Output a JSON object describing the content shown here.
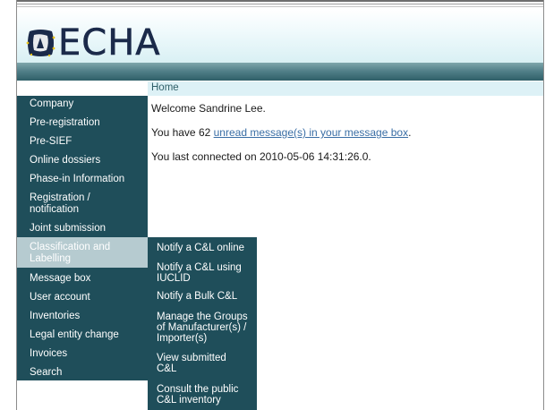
{
  "header": {
    "logo_text": "ECHA",
    "logo_icon": "echa-logo-icon"
  },
  "breadcrumb": {
    "home": "Home"
  },
  "sidebar": {
    "items": [
      {
        "label": "Company"
      },
      {
        "label": "Pre-registration"
      },
      {
        "label": "Pre-SIEF"
      },
      {
        "label": "Online dossiers"
      },
      {
        "label": "Phase-in Information"
      },
      {
        "label": "Registration /\nnotification"
      },
      {
        "label": "Joint submission"
      },
      {
        "label": "Classification and\nLabelling",
        "active": true
      },
      {
        "label": "Message box"
      },
      {
        "label": "User account"
      },
      {
        "label": "Inventories"
      },
      {
        "label": "Legal entity change"
      },
      {
        "label": "Invoices"
      },
      {
        "label": "Search"
      }
    ]
  },
  "submenu": {
    "items": [
      {
        "label": "Notify a C&L online"
      },
      {
        "label": "Notify a C&L using\nIUCLID"
      },
      {
        "label": "Notify a Bulk C&L"
      },
      {
        "label": "Manage the Groups\nof Manufacturer(s) /\nImporter(s)"
      },
      {
        "label": "View submitted\nC&L"
      },
      {
        "label": "Consult the public\nC&L inventory"
      }
    ]
  },
  "main": {
    "welcome": "Welcome Sandrine Lee.",
    "messages_prefix": "You have 62 ",
    "messages_link": "unread message(s) in your message box",
    "messages_suffix": ".",
    "last_connected": "You last connected on 2010-05-06 14:31:26.0."
  },
  "colors": {
    "nav_bg": "#1f4e5a",
    "nav_active": "#b6cbd0",
    "breadcrumb_bg": "#ddf1f6",
    "link": "#3a6ea5"
  }
}
